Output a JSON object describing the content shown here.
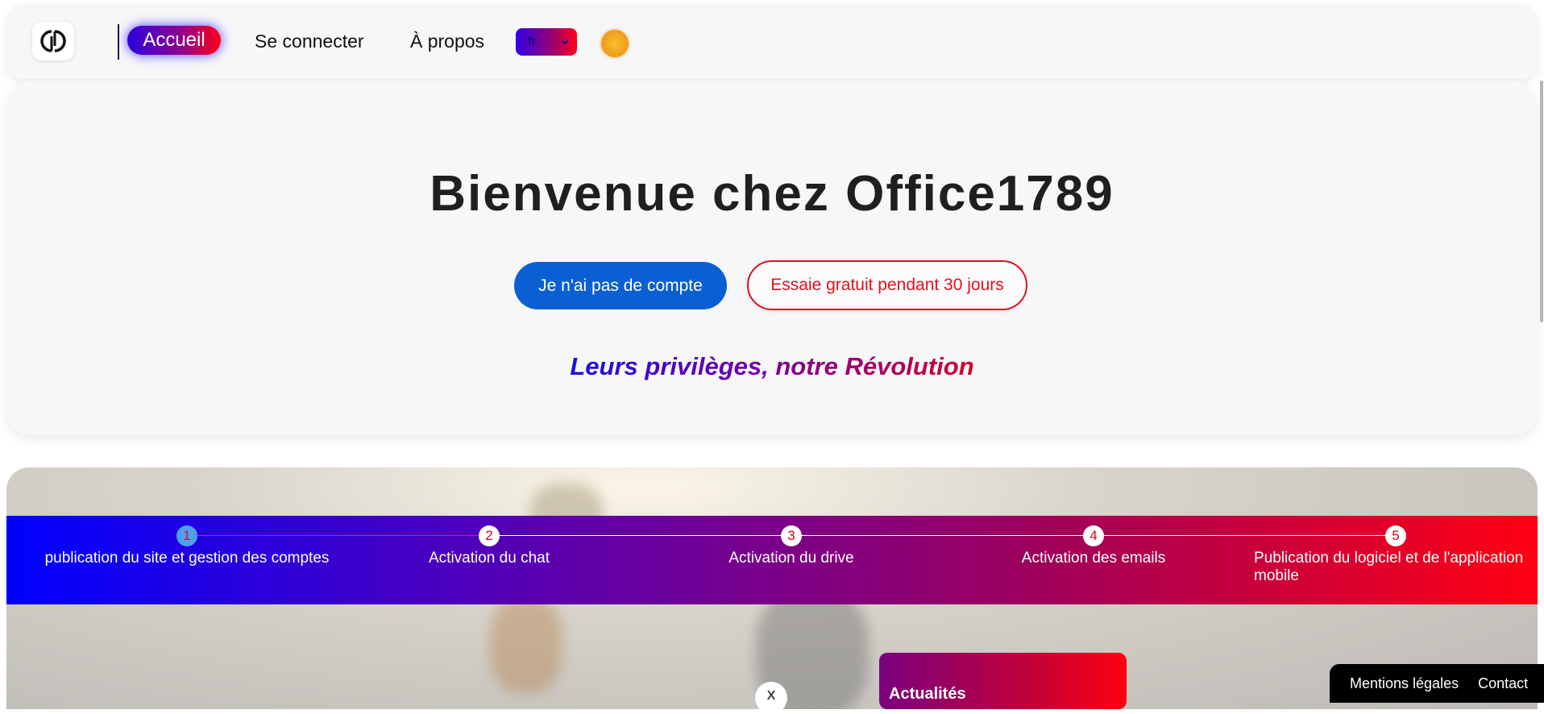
{
  "nav": {
    "home_label": "Accueil",
    "login_label": "Se connecter",
    "about_label": "À propos",
    "language_value": "fr"
  },
  "hero": {
    "title": "Bienvenue chez Office1789",
    "no_account_label": "Je n'ai pas de compte",
    "trial_label": "Essaie gratuit pendant 30 jours",
    "tagline": "Leurs privilèges, notre Révolution"
  },
  "roadmap": {
    "steps": [
      {
        "number": "1",
        "label": "publication du site et gestion des comptes"
      },
      {
        "number": "2",
        "label": "Activation du chat"
      },
      {
        "number": "3",
        "label": "Activation du drive"
      },
      {
        "number": "4",
        "label": "Activation des emails"
      },
      {
        "number": "5",
        "label": "Publication du logiciel et de l'application mobile"
      }
    ]
  },
  "news": {
    "title": "Actualités",
    "close_label": "X"
  },
  "footer": {
    "legal_label": "Mentions légales",
    "contact_label": "Contact"
  },
  "colors": {
    "primary_blue": "#0a5fd2",
    "accent_red": "#e01020",
    "gradient_start": "#0000ff",
    "gradient_end": "#ff0012",
    "sun_icon": "#f0a020"
  },
  "icons": {
    "logo": "office1789-logo-icon",
    "language_chevron": "chevron-down-icon",
    "theme": "sun-icon",
    "close": "close-icon"
  }
}
